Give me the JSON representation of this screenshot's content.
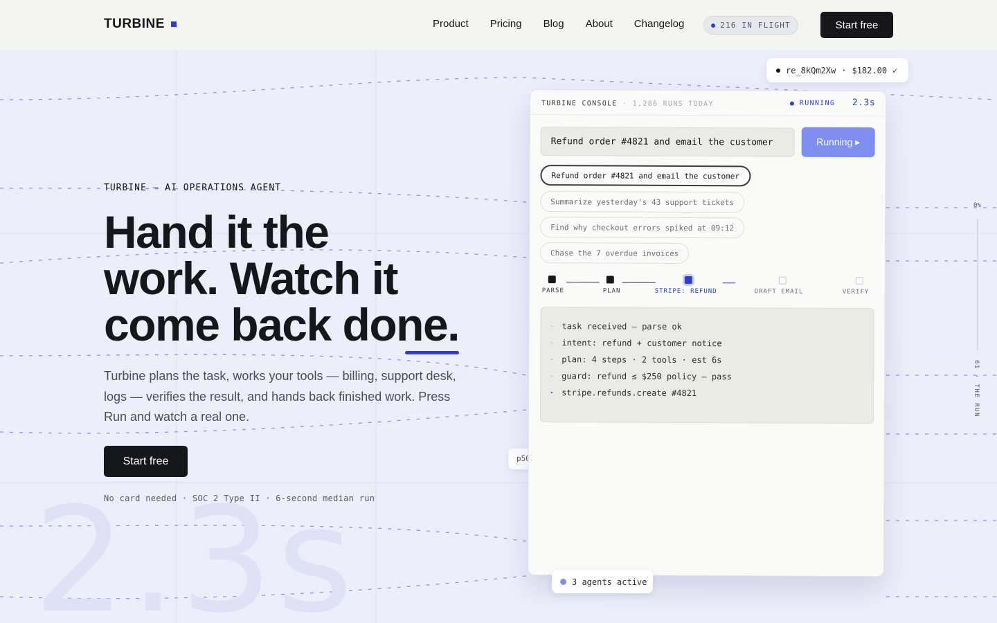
{
  "nav": {
    "logo": "TURBINE",
    "links": [
      "Product",
      "Pricing",
      "Blog",
      "About",
      "Changelog"
    ],
    "flight": "216 IN FLIGHT",
    "cta": "Start free"
  },
  "receipt": {
    "id": "re_8kQm2Xw",
    "sep": "·",
    "amount": "$182.00",
    "check": "✓"
  },
  "hero": {
    "eyebrow": "TURBINE — AI OPERATIONS AGENT",
    "headline_1": "Hand it the",
    "headline_2": "work. Watch it",
    "headline_3": "come back ",
    "headline_4": "done.",
    "subcopy": "Turbine plans the task, works your tools — billing, support desk, logs — verifies the result, and hands back finished work. Press Run and watch a real one.",
    "cta": "Start free",
    "note": "No card needed · SOC 2 Type II · 6-second median run",
    "big_number": "2.3s"
  },
  "console": {
    "title": "TURBINE CONSOLE",
    "runs": "· 1,286 RUNS TODAY",
    "status": "RUNNING",
    "time": "2.3s",
    "task_value": "Refund order #4821 and email the customer",
    "run_label": "Running ▸",
    "chips": [
      "Refund order #4821 and email the customer",
      "Summarize yesterday's 43 support tickets",
      "Find why checkout errors spiked at 09:12",
      "Chase the 7 overdue invoices"
    ],
    "steps": [
      "PARSE",
      "PLAN",
      "STRIPE: REFUND",
      "DRAFT EMAIL",
      "VERIFY"
    ],
    "log": [
      "task received — parse ok",
      "intent: refund + customer notice",
      "plan: 4 steps · 2 tools · est 6s",
      "guard: refund ≤ $250 policy — pass",
      "stripe.refunds.create #4821"
    ]
  },
  "p50_tag": "p50",
  "side": {
    "pct": "0%",
    "label": "01 · THE RUN"
  },
  "agents": "3 agents active",
  "colors": {
    "accent": "#2b3fd6",
    "run_button": "#7f8ff0",
    "background": "#eceefa",
    "ink": "#16171b"
  }
}
